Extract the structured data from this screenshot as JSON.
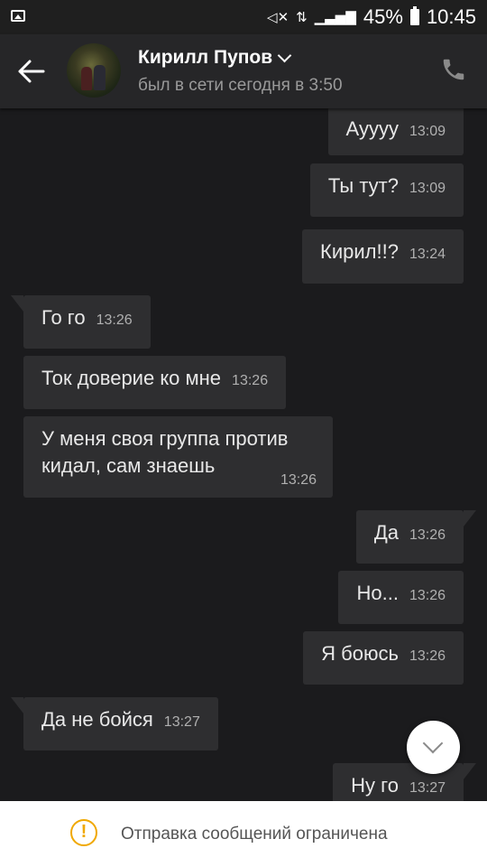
{
  "status_bar": {
    "battery": "45%",
    "time": "10:45",
    "icons": [
      "image-notification-icon",
      "mute-icon",
      "network-icon",
      "signal-icon",
      "battery-icon"
    ]
  },
  "header": {
    "name": "Кирилл Пупов",
    "status": "был в сети сегодня в 3:50",
    "icons": [
      "back-arrow-icon",
      "chevron-down-icon",
      "phone-icon"
    ]
  },
  "messages": [
    {
      "dir": "out",
      "text": "Ауууу",
      "time": "13:09"
    },
    {
      "dir": "out",
      "text": "Ты тут?",
      "time": "13:09"
    },
    {
      "dir": "out",
      "text": "Кирил!!?",
      "time": "13:24"
    },
    {
      "dir": "in",
      "text": "Го го",
      "time": "13:26"
    },
    {
      "dir": "in",
      "text": "Ток доверие ко мне",
      "time": "13:26"
    },
    {
      "dir": "in",
      "text": "У меня своя группа против кидал, сам знаешь",
      "time": "13:26"
    },
    {
      "dir": "out",
      "text": "Да",
      "time": "13:26"
    },
    {
      "dir": "out",
      "text": "Но...",
      "time": "13:26"
    },
    {
      "dir": "out",
      "text": "Я боюсь",
      "time": "13:26"
    },
    {
      "dir": "in",
      "text": "Да не бойся",
      "time": "13:27"
    },
    {
      "dir": "out",
      "text": "Ну го",
      "time": "13:27"
    }
  ],
  "notice": {
    "text": "Отправка сообщений ограничена"
  },
  "colors": {
    "background": "#1b1b1d",
    "bubble": "#2e2e30",
    "warning": "#f0a800"
  }
}
